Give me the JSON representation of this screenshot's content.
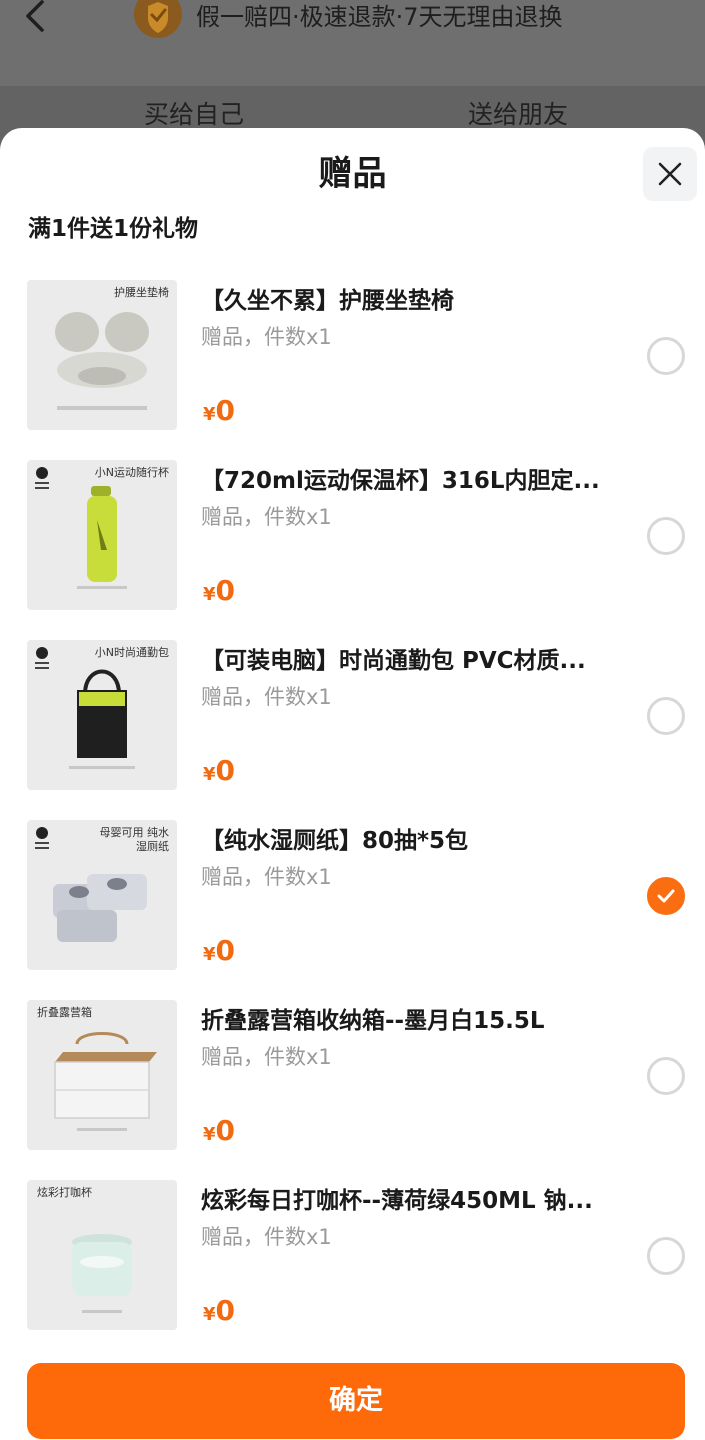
{
  "background": {
    "banner_text": "假一赔四·极速退款·7天无理由退换",
    "tabs": [
      "买给自己",
      "送给朋友"
    ]
  },
  "sheet": {
    "title": "赠品",
    "subtitle": "满1件送1份礼物",
    "confirm_label": "确定"
  },
  "gifts": [
    {
      "thumb_caption": "护腰坐垫椅",
      "name": "【久坐不累】护腰坐垫椅",
      "meta": "赠品，件数x1",
      "currency": "¥",
      "price": "0",
      "selected": false
    },
    {
      "thumb_caption": "小N运动随行杯",
      "name": "【720ml运动保温杯】316L内胆定...",
      "meta": "赠品，件数x1",
      "currency": "¥",
      "price": "0",
      "selected": false
    },
    {
      "thumb_caption": "小N时尚通勤包",
      "name": "【可装电脑】时尚通勤包 PVC材质...",
      "meta": "赠品，件数x1",
      "currency": "¥",
      "price": "0",
      "selected": false
    },
    {
      "thumb_caption": "母婴可用 纯水湿厕纸",
      "name": "【纯水湿厕纸】80抽*5包",
      "meta": "赠品，件数x1",
      "currency": "¥",
      "price": "0",
      "selected": true
    },
    {
      "thumb_caption": "折叠露营箱",
      "name": "折叠露营箱收纳箱--墨月白15.5L",
      "meta": "赠品，件数x1",
      "currency": "¥",
      "price": "0",
      "selected": false
    },
    {
      "thumb_caption": "炫彩打咖杯",
      "name": "炫彩每日打咖杯--薄荷绿450ML 钠...",
      "meta": "赠品，件数x1",
      "currency": "¥",
      "price": "0",
      "selected": false
    }
  ],
  "colors": {
    "accent": "#fe6a0a",
    "price": "#f26a10",
    "muted": "#9a9a9a"
  }
}
